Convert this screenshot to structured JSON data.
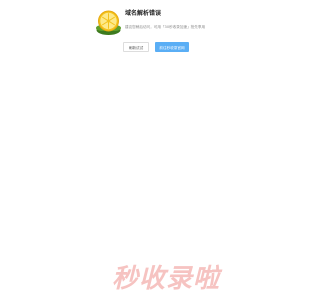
{
  "error": {
    "title": "域名解析错误",
    "description": "建议您稍后访问，可用「30秒收录加速」抢先享用",
    "buttons": {
      "refresh_label": "刷新试试",
      "home_label": "前往秒收录官网"
    },
    "logo_icon": "lemon-logo-icon"
  },
  "brand": {
    "text": "秒收录啦",
    "color": "#f6c3c1"
  },
  "colors": {
    "primary_button": "#5aaef5",
    "background": "#ffffff"
  }
}
